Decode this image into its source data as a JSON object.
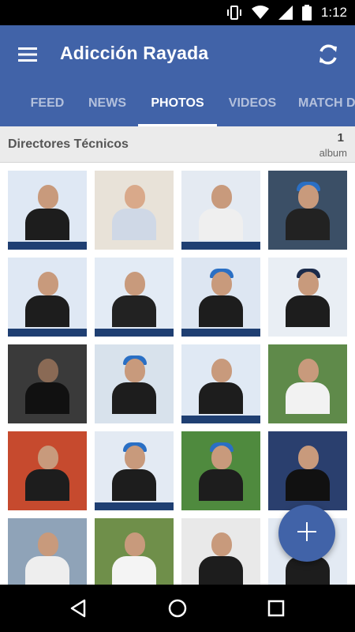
{
  "status_bar": {
    "time": "1:12",
    "icons": [
      "vibrate-icon",
      "wifi-icon",
      "signal-icon",
      "battery-icon"
    ]
  },
  "app_bar": {
    "title": "Adicción Rayada",
    "menu_icon": "menu-icon",
    "refresh_icon": "refresh-icon"
  },
  "tabs": [
    {
      "label": "FEED",
      "active": false
    },
    {
      "label": "NEWS",
      "active": false
    },
    {
      "label": "PHOTOS",
      "active": true
    },
    {
      "label": "VIDEOS",
      "active": false
    },
    {
      "label": "MATCH D",
      "active": false
    }
  ],
  "album": {
    "title": "Directores Técnicos",
    "count": "1",
    "count_label": "album"
  },
  "fab": {
    "icon": "plus-icon"
  },
  "nav_bar": {
    "icons": [
      "back-icon",
      "home-icon",
      "recents-icon"
    ]
  },
  "colors": {
    "primary": "#4163a8",
    "header_bg": "#ebebeb",
    "text_gray": "#555555"
  }
}
